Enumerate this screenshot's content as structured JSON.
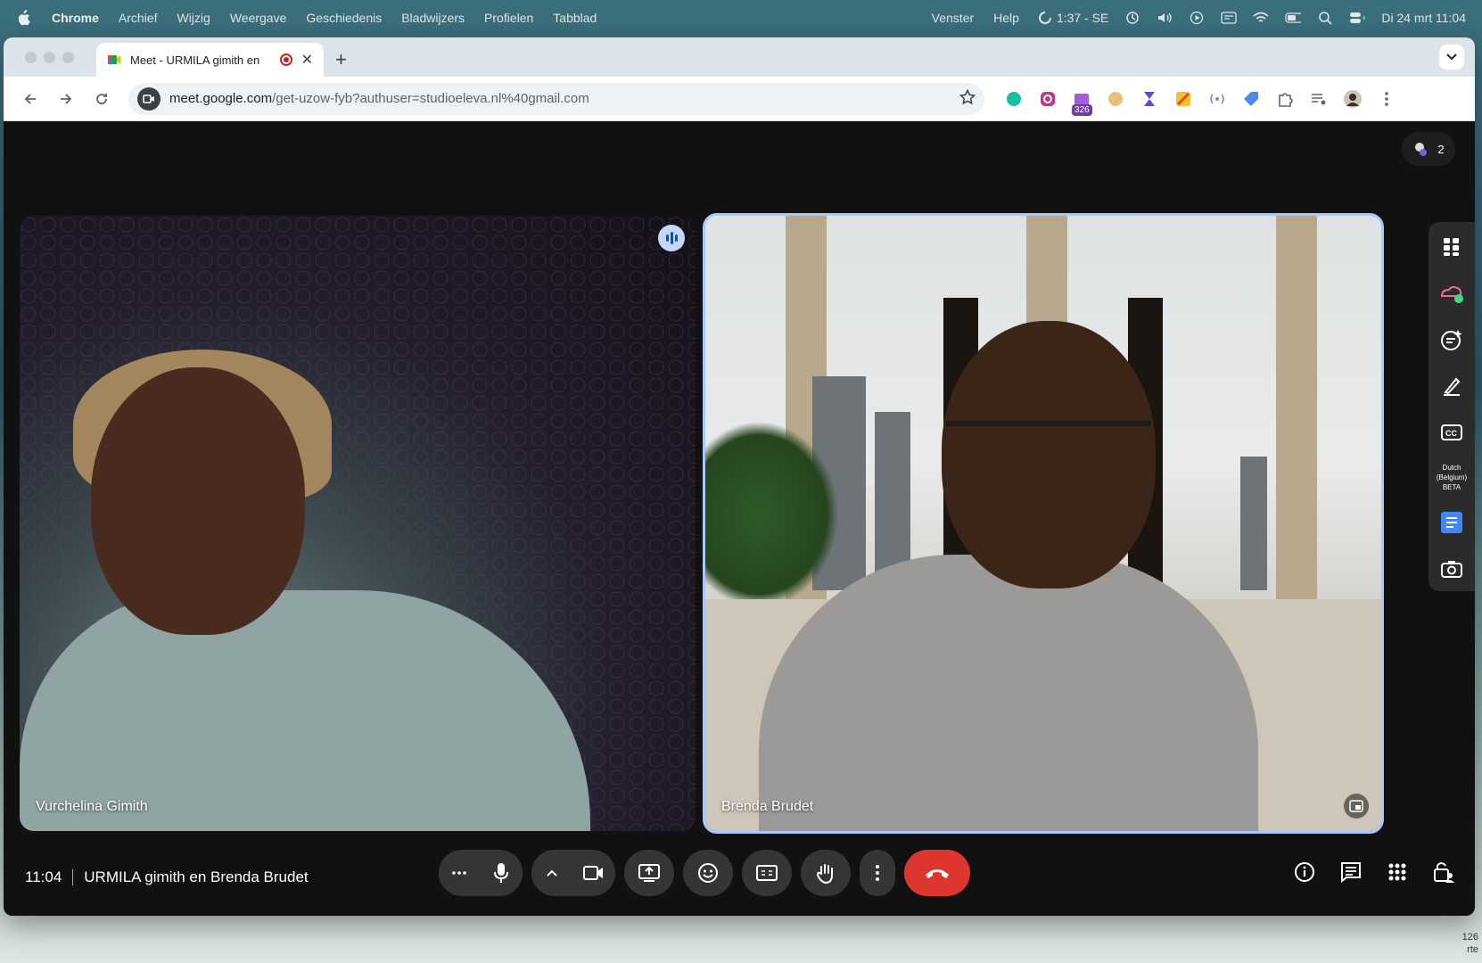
{
  "menubar": {
    "app_name": "Chrome",
    "items": [
      "Archief",
      "Wijzig",
      "Weergave",
      "Geschiedenis",
      "Bladwijzers",
      "Profielen",
      "Tabblad"
    ],
    "right_items": [
      "Venster",
      "Help"
    ],
    "timer": "1:37 - SE",
    "datetime": "Di 24 mrt  11:04"
  },
  "browser": {
    "tab_title": "Meet - URMILA gimith en",
    "url_host": "meet.google.com",
    "url_path": "/get-uzow-fyb?authuser=studioeleva.nl%40gmail.com",
    "extension_badge": "326"
  },
  "meet": {
    "participant_count": "2",
    "tiles": [
      {
        "name": "Vurchelina Gimith"
      },
      {
        "name": "Brenda Brudet"
      }
    ],
    "side_panel": {
      "caption_language": "Dutch (Belgium) BETA"
    },
    "time": "11:04",
    "meeting_title": "URMILA gimith en Brenda Brudet"
  },
  "desktop": {
    "edge_text_1": "126",
    "edge_text_2": "rte"
  },
  "colors": {
    "end_call": "#dc362e",
    "active_tile_border": "#a8c7fa",
    "control_bg": "#333537"
  }
}
